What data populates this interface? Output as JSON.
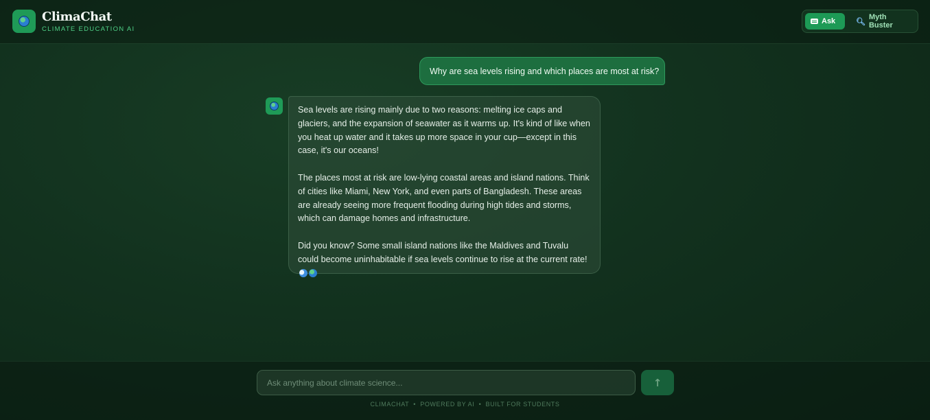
{
  "header": {
    "title": "ClimaChat",
    "subtitle": "CLIMATE EDUCATION AI",
    "modes": [
      {
        "label": "Ask",
        "icon": "chat-bubble-icon",
        "active": true
      },
      {
        "label": "Myth Buster",
        "icon": "magnifier-icon",
        "active": false
      }
    ]
  },
  "messages": {
    "user": "Why are sea levels rising and which places are most at risk?",
    "assistant": [
      "Sea levels are rising mainly due to two reasons: melting ice caps and glaciers, and the expansion of seawater as it warms up. It's kind of like when you heat up water and it takes up more space in your cup—except in this case, it's our oceans!",
      "The places most at risk are low-lying coastal areas and island nations. Think of cities like Miami, New York, and even parts of Bangladesh. These areas are already seeing more frequent flooding during high tides and storms, which can damage homes and infrastructure.",
      "Did you know? Some small island nations like the Maldives and Tuvalu could become uninhabitable if sea levels continue to rise at the current rate!"
    ]
  },
  "composer": {
    "placeholder": "Ask anything about climate science...",
    "send_icon": "arrow-up-icon",
    "send_glyph": "↑"
  },
  "footer": {
    "text": "CLIMACHAT  •  POWERED BY AI  •  BUILT FOR STUDENTS"
  },
  "colors": {
    "accent": "#1d9a56",
    "brand_sub": "#4fcf86",
    "background": "#12311e"
  }
}
